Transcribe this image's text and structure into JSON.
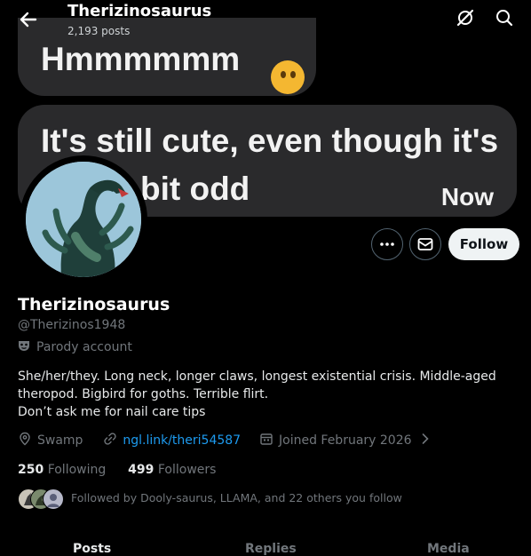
{
  "topbar": {
    "title": "Therizinosaurus",
    "post_count": "2,193 posts",
    "icons": [
      "back-arrow-icon",
      "grok-icon",
      "search-icon"
    ]
  },
  "banner": {
    "bubble1_text": "Hmmmmmm",
    "bubble1_emoji": "thinking-face-icon",
    "bubble2_line1": "It's still cute, even though it's",
    "bubble2_line2": "bit odd",
    "bubble2_time": "Now"
  },
  "actions": {
    "more_icon": "more-icon",
    "message_icon": "message-icon",
    "follow_label": "Follow"
  },
  "profile": {
    "name": "Therizinosaurus",
    "handle": "@Therizinos1948",
    "parody_label": "Parody account",
    "bio_line1": "She/her/they. Long neck, longer claws, longest existential crisis. Middle-aged",
    "bio_line2": "theropod. Bigbird for goths. Terrible flirt.",
    "bio_line3": "Don’t ask me for nail care tips",
    "location": "Swamp",
    "link": "ngl.link/theri54587",
    "joined": "Joined February 2026"
  },
  "counts": {
    "following_num": "250",
    "following_label": "Following",
    "followers_num": "499",
    "followers_label": "Followers"
  },
  "followed_by": "Followed by Dooly-saurus, LLAMA, and 22 others you follow",
  "tabs": [
    "Posts",
    "Replies",
    "Media"
  ],
  "colors": {
    "accent": "#1d9bf0",
    "background": "#000000",
    "muted": "#71767b"
  }
}
